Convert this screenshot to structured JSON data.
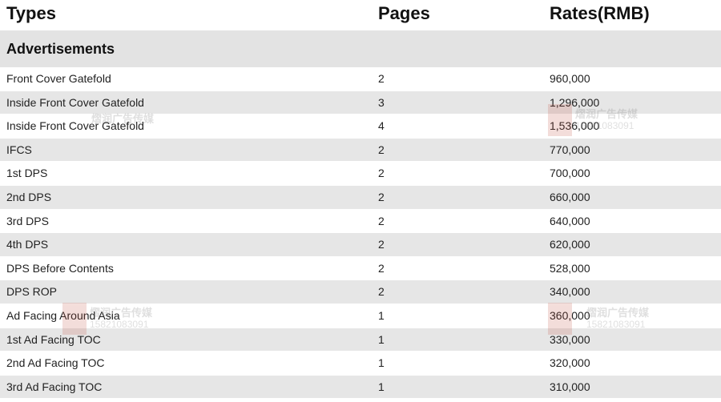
{
  "header": {
    "type_label": "Types",
    "pages_label": "Pages",
    "rates_label": "Rates(RMB)"
  },
  "section": {
    "title": "Advertisements"
  },
  "rows": [
    {
      "type": "Front Cover Gatefold",
      "pages": "2",
      "rate": "960,000"
    },
    {
      "type": "Inside Front Cover Gatefold",
      "pages": "3",
      "rate": "1,296,000"
    },
    {
      "type": "Inside Front Cover Gatefold",
      "pages": "4",
      "rate": "1,536,000"
    },
    {
      "type": "IFCS",
      "pages": "2",
      "rate": "770,000"
    },
    {
      "type": "1st DPS",
      "pages": "2",
      "rate": "700,000"
    },
    {
      "type": "2nd DPS",
      "pages": "2",
      "rate": "660,000"
    },
    {
      "type": "3rd DPS",
      "pages": "2",
      "rate": "640,000"
    },
    {
      "type": "4th DPS",
      "pages": "2",
      "rate": "620,000"
    },
    {
      "type": "DPS Before Contents",
      "pages": "2",
      "rate": "528,000"
    },
    {
      "type": "DPS ROP",
      "pages": "2",
      "rate": "340,000"
    },
    {
      "type": "Ad Facing Around Asia",
      "pages": "1",
      "rate": "360,000"
    },
    {
      "type": "1st Ad Facing TOC",
      "pages": "1",
      "rate": "330,000"
    },
    {
      "type": "2nd Ad Facing TOC",
      "pages": "1",
      "rate": "320,000"
    },
    {
      "type": "3rd Ad Facing TOC",
      "pages": "1",
      "rate": "310,000"
    }
  ],
  "watermark": {
    "text": "熠润广告传媒",
    "phone": "15821083091"
  },
  "colors": {
    "stripe": "#e6e6e6",
    "section_bg": "#e3e3e3",
    "watermark_logo": "#c24a3a"
  }
}
